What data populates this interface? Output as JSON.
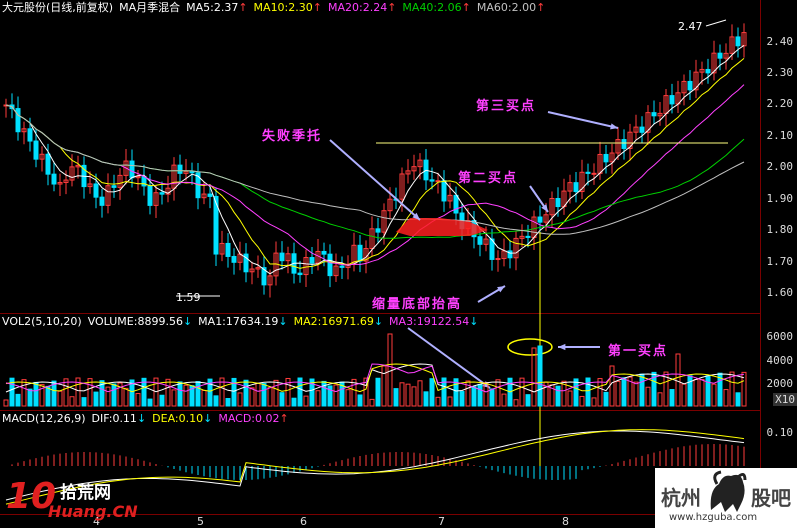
{
  "header": {
    "stock": "大元股份(日线,前复权)",
    "ma_mode": "MA月季混合",
    "ma5": "MA5:2.37",
    "ma10": "MA10:2.30",
    "ma20": "MA20:2.24",
    "ma40": "MA40:2.06",
    "ma60": "MA60:2.00",
    "arrow_up": "↑",
    "arrow_down": "↓"
  },
  "price_axis": [
    "2.40",
    "2.30",
    "2.20",
    "2.10",
    "2.00",
    "1.90",
    "1.80",
    "1.70",
    "1.60"
  ],
  "price_labels": {
    "high": "2.47",
    "low": "1.59"
  },
  "volume_header": {
    "name": "VOL2(5,10,20)",
    "volume": "VOLUME:8899.56",
    "ma1": "MA1:17634.19",
    "ma2": "MA2:16971.69",
    "ma3": "MA3:19122.54"
  },
  "volume_axis": [
    "6000",
    "4000",
    "2000"
  ],
  "volume_unit": "X10",
  "macd_header": {
    "name": "MACD(12,26,9)",
    "dif": "DIF:0.11",
    "dea": "DEA:0.10",
    "macd": "MACD:0.02"
  },
  "macd_axis": [
    "0.10"
  ],
  "x_axis": [
    "2009年",
    "4",
    "5",
    "6",
    "7",
    "8"
  ],
  "annotations": {
    "failed_support": "失败季托",
    "third_buy": "第三买点",
    "second_buy": "第二买点",
    "shrink_bottom": "缩量底部抬高",
    "first_buy": "第一买点"
  },
  "watermark_left": {
    "num": "10",
    "cn": "拾荒网",
    "en": "Huang.CN"
  },
  "watermark_right": {
    "cn1": "杭州",
    "cn2": "股吧",
    "url": "www.hzguba.com"
  },
  "colors": {
    "up": "#ff3c3c",
    "down": "#00e0ff",
    "ma5": "#ffffff",
    "ma10": "#ffff00",
    "ma20": "#ff40ff",
    "ma40": "#00d000",
    "ma60": "#c0c0c0",
    "border": "#7a0000",
    "annotation": "#ff40ff"
  }
}
